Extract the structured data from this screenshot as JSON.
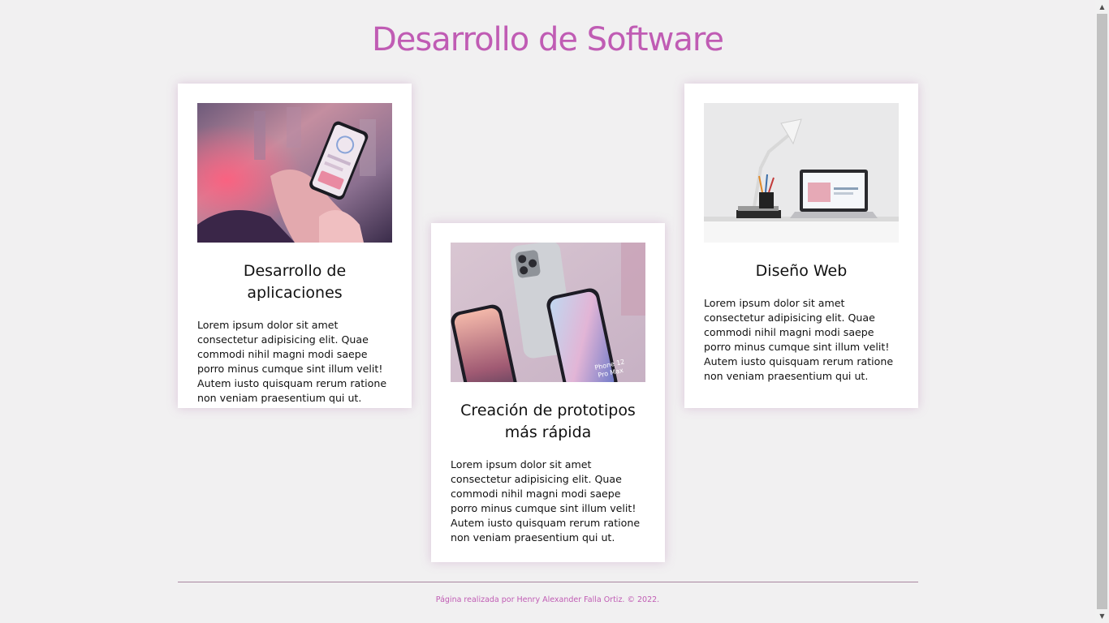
{
  "page": {
    "title": "Desarrollo de Software"
  },
  "cards": [
    {
      "title": "Desarrollo de aplicaciones",
      "text": "Lorem ipsum dolor sit amet consectetur adipisicing elit. Quae commodi nihil magni modi saepe porro minus cumque sint illum velit! Autem iusto quisquam rerum ratione non veniam praesentium qui ut.",
      "image": "hand-holding-phone-photo"
    },
    {
      "title": "Creación de prototipos más rápida",
      "text": "Lorem ipsum dolor sit amet consectetur adipisicing elit. Quae commodi nihil magni modi saepe porro minus cumque sint illum velit! Autem iusto quisquam rerum ratione non veniam praesentium qui ut.",
      "image": "iphone-12-pro-max-mockup-photo",
      "image_text": "Phone 12 Pro Max"
    },
    {
      "title": "Diseño Web",
      "text": "Lorem ipsum dolor sit amet consectetur adipisicing elit. Quae commodi nihil magni modi saepe porro minus cumque sint illum velit! Autem iusto quisquam rerum ratione non veniam praesentium qui ut.",
      "image": "desk-lamp-laptop-photo"
    }
  ],
  "footer": {
    "text": "Página realizada por Henry Alexander Falla Ortiz. © 2022."
  },
  "colors": {
    "accent": "#c05cb4",
    "background": "#f1f0f1",
    "card": "#ffffff"
  }
}
